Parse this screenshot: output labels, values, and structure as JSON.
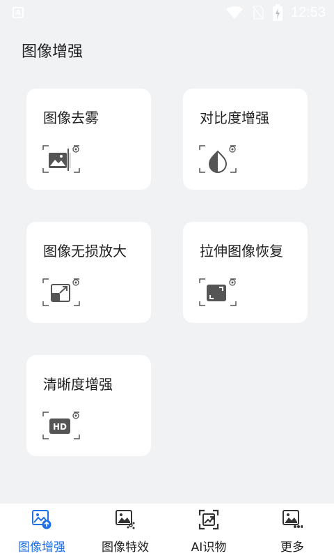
{
  "status_bar": {
    "time": "12:53",
    "left_badge": "A",
    "icons": [
      "wifi-icon",
      "no-sim-icon",
      "battery-icon"
    ]
  },
  "page": {
    "title": "图像增强"
  },
  "cards": [
    {
      "label": "图像去雾",
      "icon": "dehaze-icon"
    },
    {
      "label": "对比度增强",
      "icon": "contrast-icon"
    },
    {
      "label": "图像无损放大",
      "icon": "upscale-icon"
    },
    {
      "label": "拉伸图像恢复",
      "icon": "stretch-restore-icon"
    },
    {
      "label": "清晰度增强",
      "icon": "hd-icon"
    }
  ],
  "nav": {
    "items": [
      {
        "label": "图像增强",
        "icon": "image-enhance-icon",
        "active": true
      },
      {
        "label": "图像特效",
        "icon": "image-effects-icon",
        "active": false
      },
      {
        "label": "AI识物",
        "icon": "ai-recognize-icon",
        "active": false
      },
      {
        "label": "更多",
        "icon": "more-icon",
        "active": false
      }
    ]
  },
  "colors": {
    "background": "#f1f2f4",
    "card": "#ffffff",
    "accent": "#1f6fe5",
    "icon_gray": "#555555"
  }
}
